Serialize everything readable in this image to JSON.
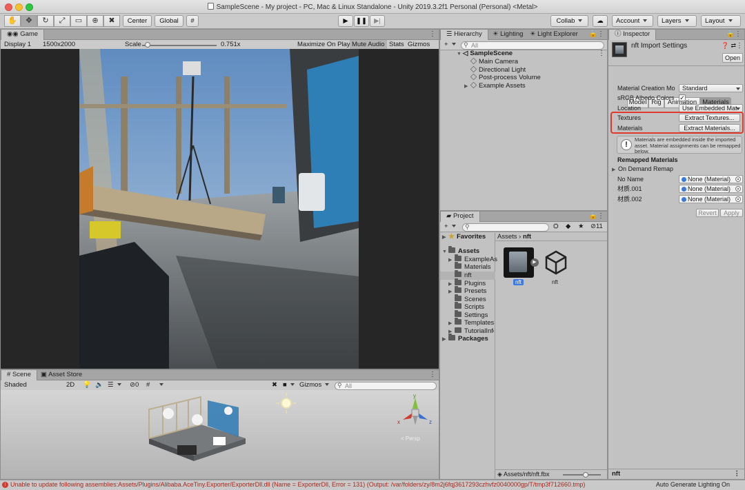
{
  "window": {
    "title": "SampleScene - My project - PC, Mac & Linux Standalone - Unity 2019.3.2f1 Personal (Personal) <Metal>"
  },
  "toolbar": {
    "tools": [
      "hand-tool",
      "move-tool",
      "rotate-tool",
      "scale-tool",
      "rect-tool",
      "transform-tool",
      "custom-tool"
    ],
    "pivot_mode": "Center",
    "pivot_rotation": "Global",
    "collab": "Collab",
    "account": "Account",
    "layers": "Layers",
    "layout": "Layout"
  },
  "game": {
    "tab": "Game",
    "display": "Display 1",
    "resolution": "1500x2000",
    "scale_label": "Scale",
    "scale_value": "0.751x",
    "maximize_on_play": "Maximize On Play",
    "mute_audio": "Mute Audio",
    "stats": "Stats",
    "gizmos": "Gizmos"
  },
  "scene": {
    "tabs": [
      "Scene",
      "Asset Store"
    ],
    "shading": "Shaded",
    "mode_2d": "2D",
    "hidden_count": "0",
    "gizmos": "Gizmos",
    "search_placeholder": "All",
    "view_mode": "< Persp",
    "axis_labels": {
      "x": "x",
      "y": "y",
      "z": "z"
    }
  },
  "hierarchy": {
    "tabs": [
      "Hierarchy",
      "Lighting",
      "Light Explorer"
    ],
    "search_placeholder": "All",
    "scene_name": "SampleScene",
    "items": [
      "Main Camera",
      "Directional Light",
      "Post-process Volume",
      "Example Assets"
    ]
  },
  "project": {
    "tab": "Project",
    "hidden_count": "11",
    "favorites": "Favorites",
    "assets": "Assets",
    "folders": [
      "ExampleAs",
      "Materials",
      "nft",
      "Plugins",
      "Presets",
      "Scenes",
      "Scripts",
      "Settings",
      "Templates",
      "TutorialInfo"
    ],
    "packages": "Packages",
    "breadcrumb": [
      "Assets",
      "nft"
    ],
    "grid_items": [
      "nft",
      "nft"
    ],
    "footer_path": "Assets/nft/nft.fbx"
  },
  "inspector": {
    "tab": "Inspector",
    "asset_title": "nft Import Settings",
    "open_button": "Open",
    "tabs": [
      "Model",
      "Rig",
      "Animation",
      "Materials"
    ],
    "active_tab": "Materials",
    "rows": {
      "material_creation_label": "Material Creation Mo",
      "material_creation_value": "Standard",
      "srgb_label": "sRGB Albedo Colors",
      "srgb_checked": true,
      "location_label": "Location",
      "location_value": "Use Embedded Mat",
      "textures_label": "Textures",
      "textures_button": "Extract Textures...",
      "materials_label": "Materials",
      "materials_button": "Extract Materials..."
    },
    "info_text": "Materials are embedded inside the imported asset. Material assignments can be remapped below.",
    "remapped_title": "Remapped Materials",
    "on_demand": "On Demand Remap",
    "remaps": [
      {
        "name": "No Name",
        "value": "None (Material)"
      },
      {
        "name": "材质.001",
        "value": "None (Material)"
      },
      {
        "name": "材质.002",
        "value": "None (Material)"
      }
    ],
    "revert": "Revert",
    "apply": "Apply",
    "footer_name": "nft",
    "highlight_color": "#e0392b"
  },
  "status": {
    "error": "Unable to update following assemblies:Assets/Plugins/Alibaba.AceTiny.Exporter/ExporterDll.dll (Name = ExporterDll, Error = 131) (Output: /var/folders/zy/8m2j6fqj3617293czhvfz0040000gp/T/tmp3f712660.tmp)",
    "right": "Auto Generate Lighting On"
  }
}
